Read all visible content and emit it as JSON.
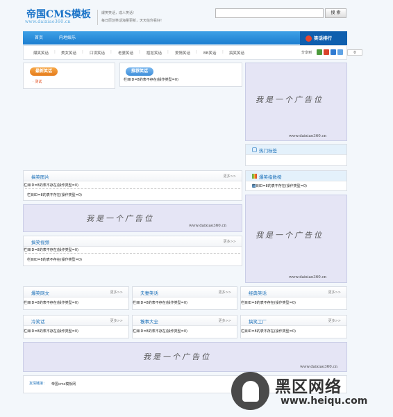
{
  "header": {
    "logo_title": "帝国CMS模板",
    "logo_url": "www.daixiao360.cn",
    "slogan_line1": "爆笑笑话，成人笑话!",
    "slogan_line2": "每日原创笑话海量更新，天天给你看好!",
    "search_placeholder": "",
    "search_button": "搜 索"
  },
  "nav": {
    "items": [
      "首页",
      "内地娱乐"
    ],
    "rank_label": "笑话排行"
  },
  "subnav": {
    "items": [
      "爆笑笑话",
      "美女笑话",
      "口误笑话",
      "老婆笑话",
      "尴尬笑话",
      "爱情笑话",
      "BB笑话",
      "搞笑笑话"
    ],
    "share_label": "分享到",
    "share_count": "0"
  },
  "latest": {
    "tag": "最新笑话",
    "item": "测试"
  },
  "recommend": {
    "tag": "推荐笑话",
    "text": "栏目ID=8的表不存在(操作类型=0)"
  },
  "ad": {
    "text": "我是一个广告位",
    "url": "www.daixiao360.cn"
  },
  "hot_tags": {
    "title": "热门标签"
  },
  "funny_pics": {
    "title": "搞笑图片",
    "more": "更多>>",
    "line1": "栏目ID=8的表不存在(操作类型=0)",
    "line2": "栏目ID=8的表不存在(操作类型=0)"
  },
  "funny_index": {
    "title": "爆笑指数榜",
    "line1": "栏目ID=8的表不存在(操作类型=0)"
  },
  "funny_video": {
    "title": "搞笑视频",
    "more": "更多>>",
    "line1": "栏目ID=8的表不存在(操作类型=0)",
    "line2": "栏目ID=8的表不存在(操作类型=0)"
  },
  "grid": [
    {
      "title": "爆笑网文",
      "more": "更多>>",
      "text": "栏目ID=8的表不存在(操作类型=0)"
    },
    {
      "title": "夫妻笑话",
      "more": "更多>>",
      "text": "栏目ID=8的表不存在(操作类型=0)"
    },
    {
      "title": "经典笑话",
      "more": "更多>>",
      "text": "栏目ID=8的表不存在(操作类型=0)"
    },
    {
      "title": "冷笑话",
      "more": "更多>>",
      "text": "栏目ID=8的表不存在(操作类型=0)"
    },
    {
      "title": "糗事大全",
      "more": "更多>>",
      "text": "栏目ID=8的表不存在(操作类型=0)"
    },
    {
      "title": "搞笑工厂",
      "more": "更多>>",
      "text": "栏目ID=8的表不存在(操作类型=0)"
    }
  ],
  "links": {
    "label": "友情链接：",
    "item": "帝国cms模板网"
  },
  "watermark": {
    "big": "黑区网络",
    "url": "www.heiqu.com"
  },
  "colors": {
    "accent": "#1a73c8",
    "nav_blue": "#1c7ed0",
    "tag_orange": "#f0902c",
    "tag_blue": "#5aa0e0",
    "ad_bg": "#e5e5f5"
  }
}
